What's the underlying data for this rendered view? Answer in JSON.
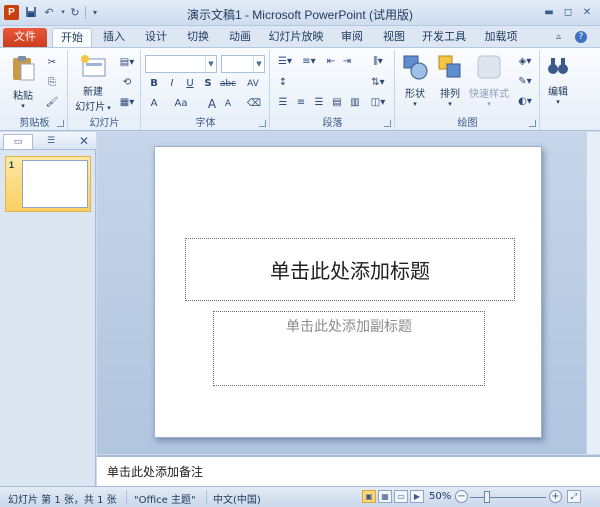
{
  "titlebar": {
    "app_icon": "P",
    "title": "演示文稿1 - Microsoft PowerPoint (试用版)",
    "quick_access": [
      "save-icon",
      "undo-icon",
      "redo-icon",
      "customize-icon"
    ]
  },
  "tabs": [
    {
      "label": "文件"
    },
    {
      "label": "开始"
    },
    {
      "label": "插入"
    },
    {
      "label": "设计"
    },
    {
      "label": "切换"
    },
    {
      "label": "动画"
    },
    {
      "label": "幻灯片放映"
    },
    {
      "label": "审阅"
    },
    {
      "label": "视图"
    },
    {
      "label": "开发工具"
    },
    {
      "label": "加载项"
    }
  ],
  "active_tab": "开始",
  "ribbon": {
    "clipboard": {
      "label": "剪贴板",
      "paste": "粘贴"
    },
    "slides": {
      "label": "幻灯片",
      "new_slide_line1": "新建",
      "new_slide_line2": "幻灯片"
    },
    "font": {
      "label": "字体",
      "bold": "B",
      "italic": "I",
      "underline": "U",
      "strike": "S",
      "shadow": "abc",
      "spacing": "AV",
      "font_color": "A",
      "change_case": "Aa",
      "grow": "A",
      "shrink": "A"
    },
    "paragraph": {
      "label": "段落"
    },
    "drawing": {
      "label": "绘图",
      "shapes": "形状",
      "arrange": "排列",
      "quick_styles": "快速样式"
    },
    "editing": {
      "label": "编辑"
    }
  },
  "slides_panel": {
    "slide_number": "1"
  },
  "slide": {
    "title_placeholder": "单击此处添加标题",
    "subtitle_placeholder": "单击此处添加副标题"
  },
  "notes": {
    "placeholder": "单击此处添加备注"
  },
  "statusbar": {
    "slide_info": "幻灯片 第 1 张，共 1 张",
    "theme": "\"Office 主题\"",
    "language": "中文(中国)",
    "zoom": "50%",
    "zoom_level": 0.5
  },
  "colors": {
    "file_tab": "#d04a2a",
    "selected_thumb": "#fbd776",
    "ribbon_bg": "#f0f5fb"
  }
}
